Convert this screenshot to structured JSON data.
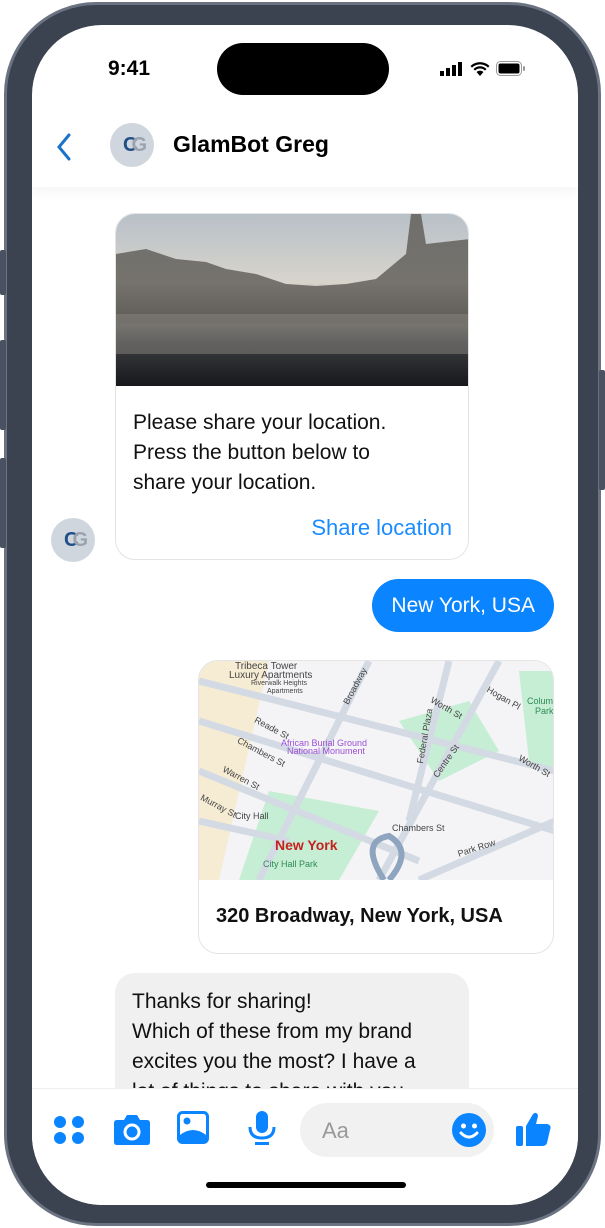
{
  "status_bar": {
    "time": "9:41"
  },
  "header": {
    "title": "GlamBot Greg",
    "avatar_initials": "CG"
  },
  "messages": {
    "card": {
      "text_lines": [
        "Please share your location.",
        "Press the button below to",
        "share your location."
      ],
      "action": "Share location"
    },
    "user_reply": "New York, USA",
    "location": {
      "address": "320 Broadway, New York, USA",
      "map_labels": {
        "tribeca": "Tribeca Tower",
        "luxury": "Luxury Apartments",
        "riverwalk": "Riverwalk Heights",
        "apartments": "Apartments",
        "broadway": "Broadway",
        "reade": "Reade St",
        "chambers": "Chambers St",
        "warren": "Warren St",
        "murray": "Murray St",
        "city_hall": "City Hall",
        "monument1": "African Burial Ground",
        "monument2": "National Monument",
        "new_york": "New York",
        "city_hall_park": "City Hall Park",
        "chambers_station": "Chambers St",
        "park_row": "Park Row",
        "federal_plaza": "Federal Plaza",
        "centre": "Centre St",
        "worth": "Worth St",
        "worth2": "Worth St",
        "hogan": "Hogan Pl",
        "columbus": "Columb",
        "columbus2": "Park"
      }
    },
    "bot_reply_lines": [
      "Thanks for sharing!",
      "Which of these from my brand",
      "excites you the most? I have a",
      "lot of things to share with you"
    ]
  },
  "composer": {
    "placeholder": "Aa"
  },
  "colors": {
    "accent": "#0a84ff",
    "link": "#1a8cff"
  }
}
